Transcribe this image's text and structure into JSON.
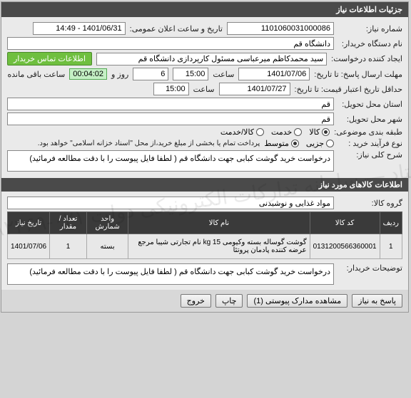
{
  "panel_title": "جزئیات اطلاعات نیاز",
  "fields": {
    "need_no_label": "شماره نیاز:",
    "need_no": "1101060031000086",
    "announce_label": "تاریخ و ساعت اعلان عمومی:",
    "announce": "1401/06/31 - 14:49",
    "buyer_org_label": "نام دستگاه خریدار:",
    "buyer_org": "دانشگاه قم",
    "creator_label": "ایجاد کننده درخواست:",
    "creator": "سید محمدکاظم میرعباسی مسئول کارپردازی دانشگاه قم",
    "contact_btn": "اطلاعات تماس خریدار",
    "deadline_label": "مهلت ارسال پاسخ: تا تاریخ:",
    "deadline_date": "1401/07/06",
    "time_label": "ساعت",
    "deadline_time": "15:00",
    "days_label": "روز و",
    "days": "6",
    "countdown": "00:04:02",
    "remain_label": "ساعت باقی مانده",
    "price_valid_label": "حداقل تاریخ اعتبار قیمت: تا تاریخ:",
    "price_valid_date": "1401/07/27",
    "price_valid_time": "15:00",
    "delivery_addr_label": "استان محل تحویل:",
    "delivery_addr": "قم",
    "delivery_city_label": "شهر محل تحویل:",
    "delivery_city": "قم",
    "category_label": "طبقه بندی موضوعی:",
    "cat_goods": "کالا",
    "cat_service": "خدمت",
    "cat_both": "کالا/خدمت",
    "process_label": "نوع فرآیند خرید :",
    "proc_small": "جزیی",
    "proc_medium": "متوسط",
    "payment_note": "پرداخت تمام یا بخشی از مبلغ خرید،از محل \"اسناد خزانه اسلامی\" خواهد بود.",
    "desc_label": "شرح کلی نیاز:",
    "desc": "درخواست خرید گوشت کبابی جهت دانشگاه قم ( لطفا فایل پیوست را با دقت مطالعه فرمائید)"
  },
  "items_header": "اطلاعات کالاهای مورد نیاز",
  "group_label": "گروه کالا:",
  "group_value": "مواد غذایی و نوشیدنی",
  "table": {
    "headers": [
      "ردیف",
      "کد کالا",
      "نام کالا",
      "واحد شمارش",
      "تعداد / مقدار",
      "تاریخ نیاز"
    ],
    "row": {
      "idx": "1",
      "code": "0131200566360001",
      "name": "گوشت گوساله بسته وکیومی 15 kg نام تجارتی شیبا مرجع عرضه کننده پادمان پروتئا",
      "unit": "بسته",
      "qty": "1",
      "date": "1401/07/06"
    }
  },
  "buyer_note_label": "توضیحات خریدار:",
  "buyer_note": "درخواست خرید گوشت کبابی جهت دانشگاه قم ( لطفا فایل پیوست را با دقت مطالعه فرمائید)",
  "footer": {
    "reply": "پاسخ به نیاز",
    "attach": "مشاهده مدارک پیوستی (1)",
    "print": "چاپ",
    "exit": "خروج"
  },
  "watermark": "ستاد — سامانه تدارکات الکترونیکی دولت  ۰۲۱-۸۸۲۴۶۹"
}
